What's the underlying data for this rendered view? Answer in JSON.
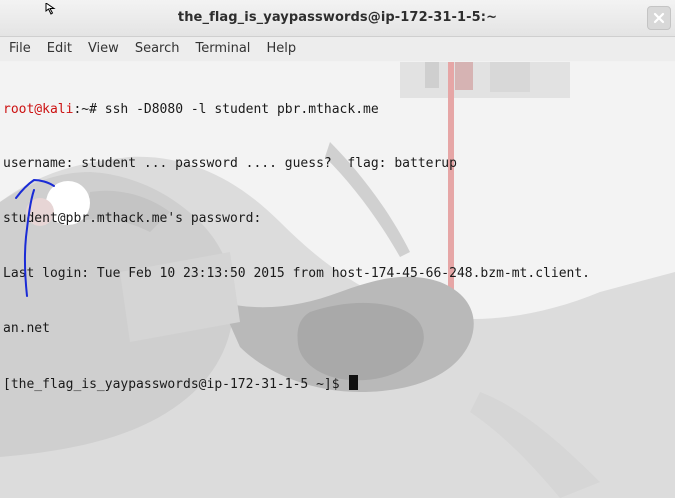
{
  "window": {
    "title": "the_flag_is_yaypasswords@ip-172-31-1-5:~"
  },
  "menu": [
    {
      "label": "File"
    },
    {
      "label": "Edit"
    },
    {
      "label": "View"
    },
    {
      "label": "Search"
    },
    {
      "label": "Terminal"
    },
    {
      "label": "Help"
    }
  ],
  "terminal": {
    "prompt_user": "root@kali",
    "prompt_rest": ":~# ssh -D8080 -l student pbr.mthack.me",
    "line2": "username: student ... password .... guess?  flag: batterup",
    "line3": "student@pbr.mthack.me's password:",
    "line4": "Last login: Tue Feb 10 23:13:50 2015 from host-174-45-66-248.bzm-mt.client.",
    "line5": "an.net",
    "line6": "[the_flag_is_yaypasswords@ip-172-31-1-5 ~]$ "
  },
  "colors": {
    "prompt_red": "#cc1111",
    "annotation_blue": "#1a2bd6",
    "text": "#1a1a1a"
  },
  "icons": {
    "close": "close-icon",
    "pointer": "mouse-pointer-icon"
  }
}
